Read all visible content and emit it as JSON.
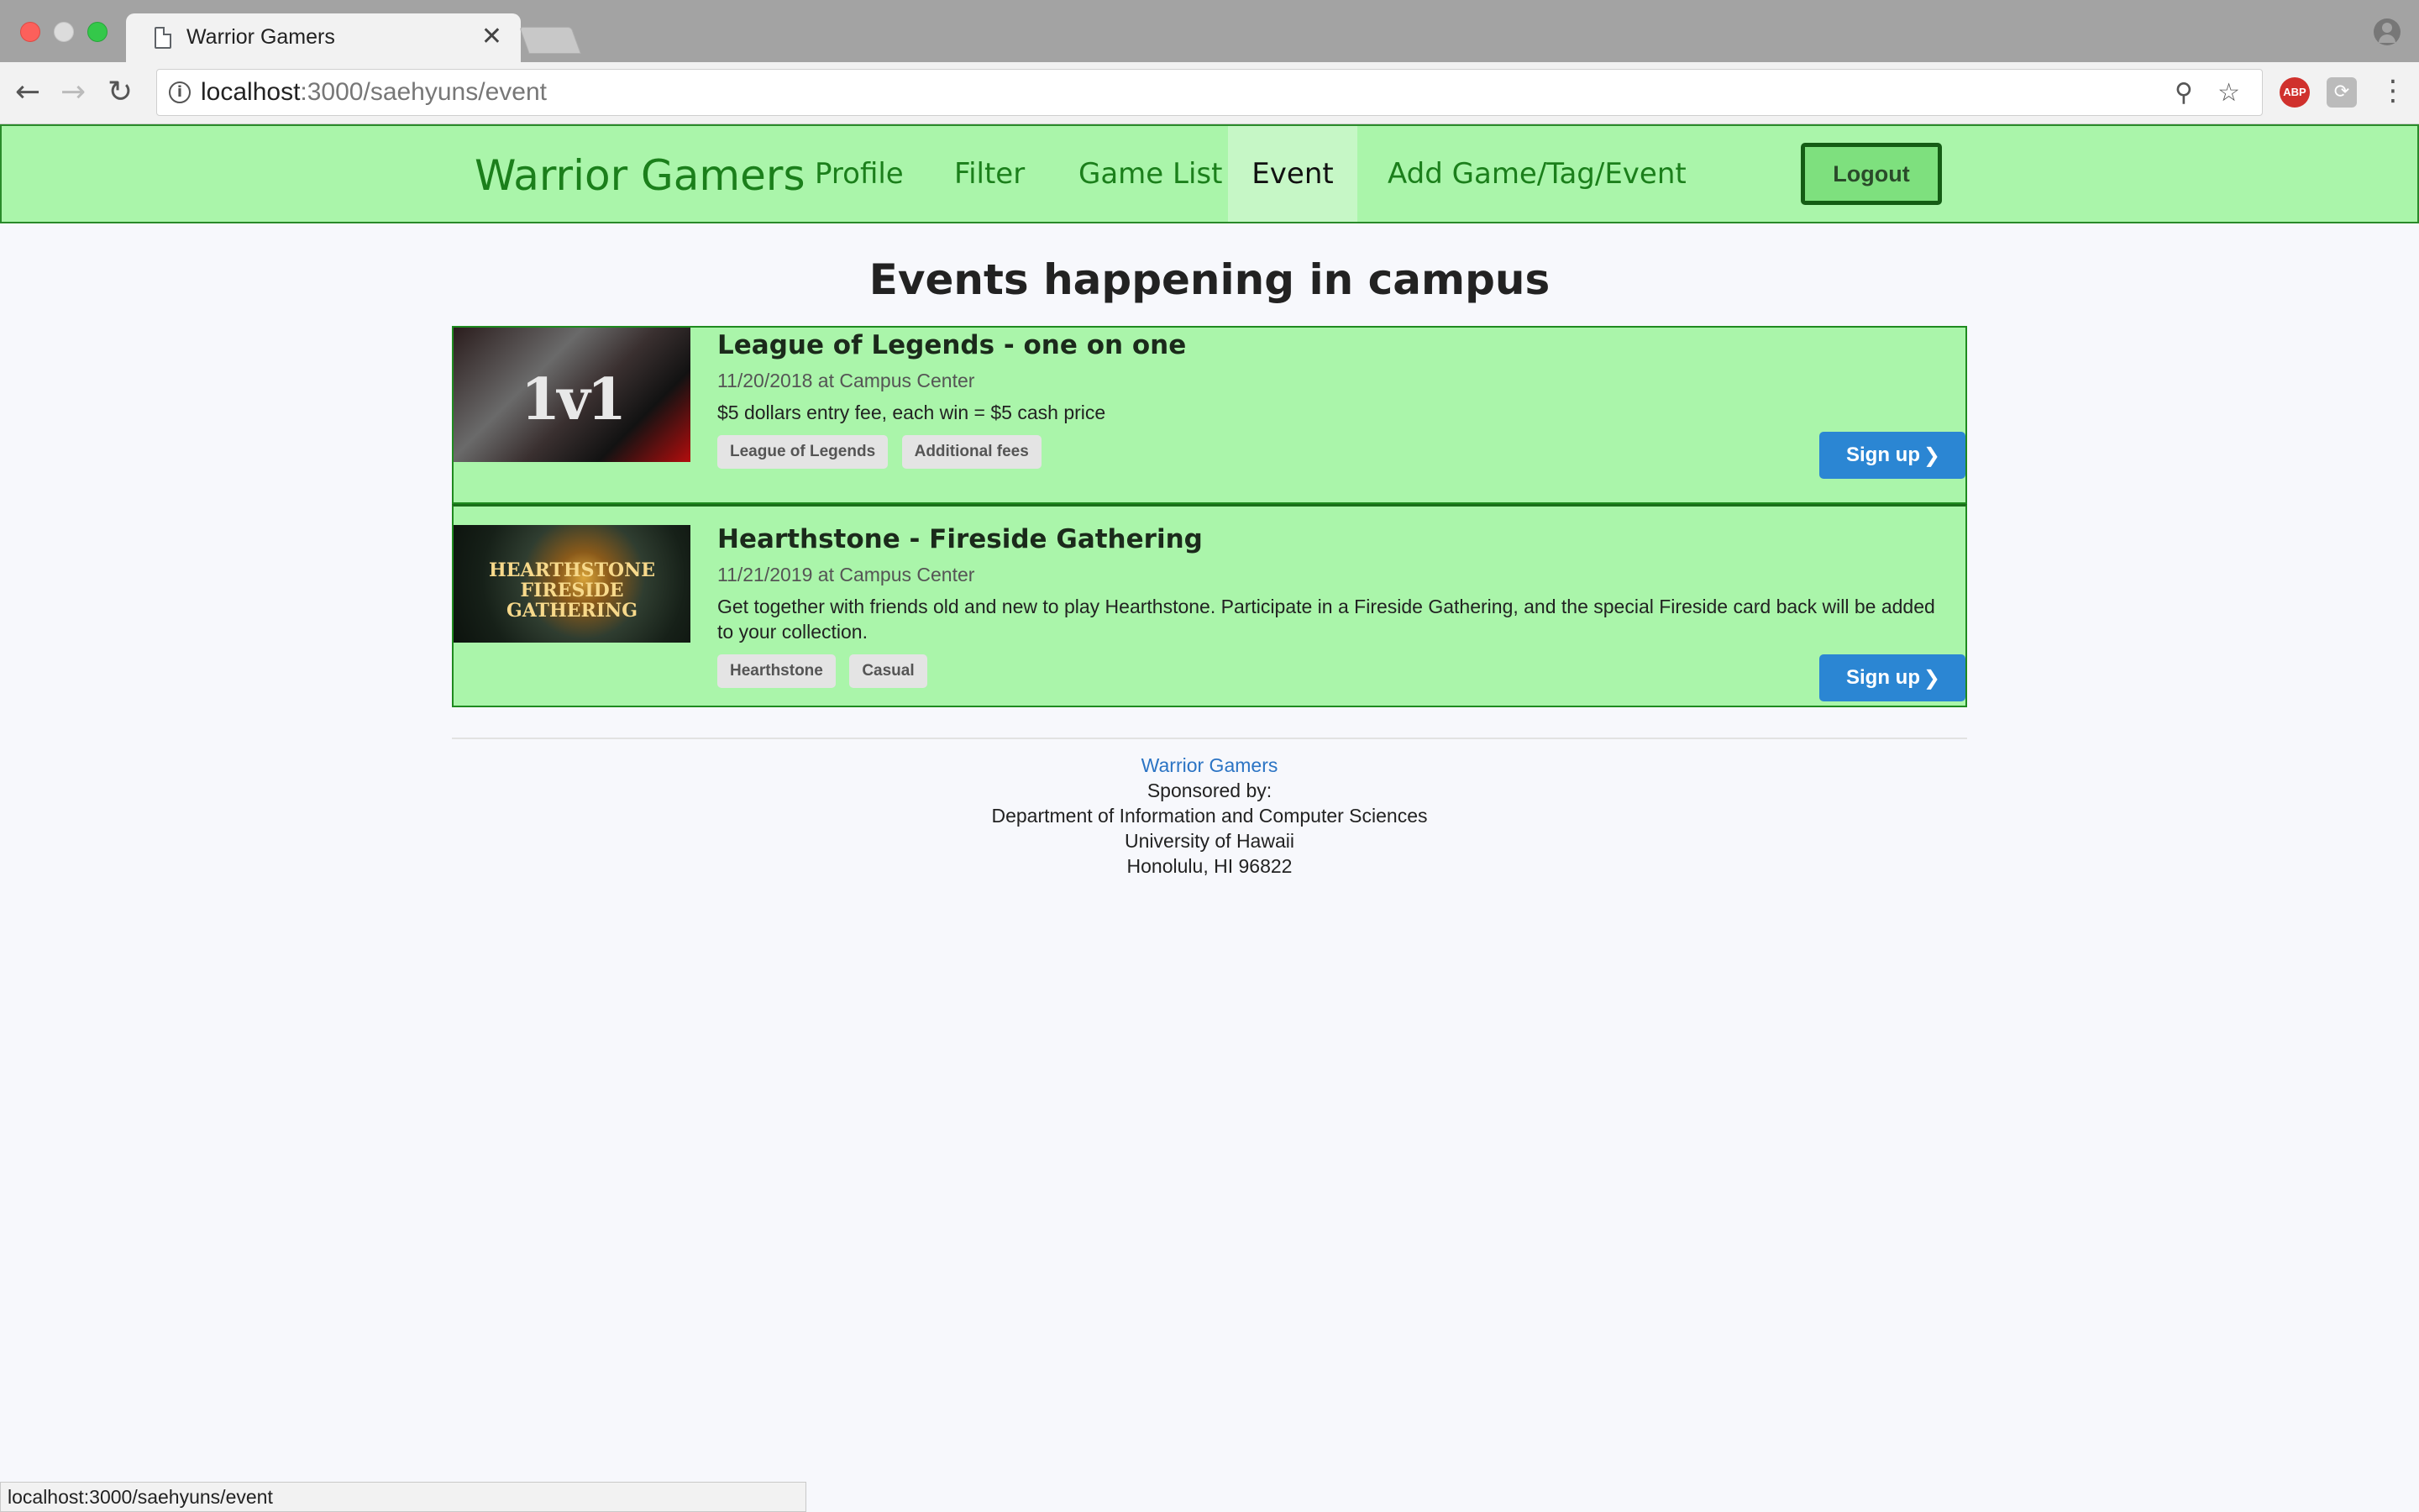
{
  "browser": {
    "tab_title": "Warrior Gamers",
    "tab_close": "✕",
    "url_host": "localhost",
    "url_path": ":3000/saehyuns/event",
    "status_url": "localhost:3000/saehyuns/event",
    "icons": {
      "back": "←",
      "forward": "→",
      "reload": "↻",
      "info": "i",
      "zoom": "⚲",
      "star": "☆",
      "abp": "ABP",
      "extension": "⟳",
      "menu": "⋮"
    }
  },
  "navbar": {
    "brand": "Warrior Gamers",
    "items": [
      {
        "label": "Profile"
      },
      {
        "label": "Filter"
      },
      {
        "label": "Game List"
      },
      {
        "label": "Event",
        "active": true
      },
      {
        "label": "Add Game/Tag/Event"
      }
    ],
    "logout_label": "Logout"
  },
  "main": {
    "title": "Events happening in campus",
    "events": [
      {
        "title": "League of Legends - one on one",
        "meta": "11/20/2018 at Campus Center",
        "description": "$5 dollars entry fee, each win = $5 cash price",
        "thumb_text": "1v1",
        "tags": [
          "League of Legends",
          "Additional fees"
        ],
        "signup_label": "Sign up",
        "signup_chevron": "❯"
      },
      {
        "title": "Hearthstone - Fireside Gathering",
        "meta": "11/21/2019 at Campus Center",
        "description": "Get together with friends old and new to play Hearthstone. Participate in a Fireside Gathering, and the special Fireside card back will be added to your collection.",
        "thumb_text": "HEARTHSTONE FIRESIDE GATHERING",
        "tags": [
          "Hearthstone",
          "Casual"
        ],
        "signup_label": "Sign up",
        "signup_chevron": "❯"
      }
    ]
  },
  "footer": {
    "brand": "Warrior Gamers",
    "sponsored": "Sponsored by:",
    "dept": "Department of Information and Computer Sciences",
    "university": "University of Hawaii",
    "address": "Honolulu, HI 96822"
  },
  "colors": {
    "navbar_bg": "#aaf5aa",
    "brand_green": "#1b7f1b",
    "signup_blue": "#2b86d3",
    "card_border": "#1f8a1f"
  }
}
